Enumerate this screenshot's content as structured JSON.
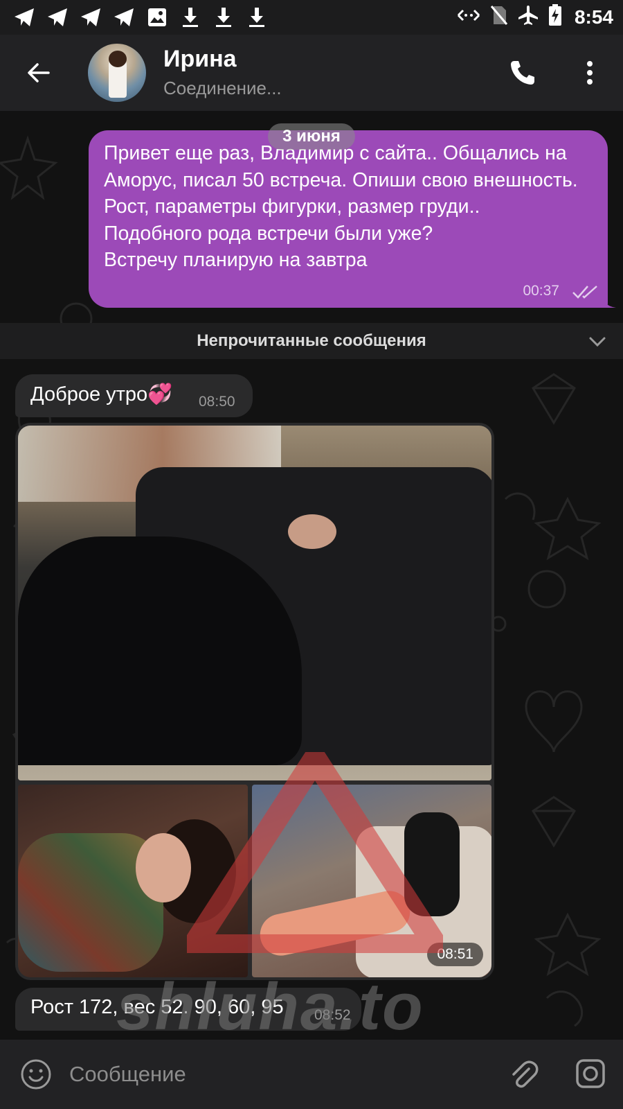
{
  "status_bar": {
    "time": "8:54",
    "left_icons": [
      "telegram-icon",
      "telegram-icon",
      "telegram-icon",
      "telegram-icon",
      "image-icon",
      "download-icon",
      "download-icon",
      "download-icon"
    ],
    "right_icons": [
      "data-saver-icon",
      "no-sim-icon",
      "airplane-icon",
      "battery-charging-icon"
    ]
  },
  "header": {
    "contact_name": "Ирина",
    "status": "Соединение..."
  },
  "chat": {
    "date_chip": "3 июня",
    "outgoing": {
      "text": "Привет еще раз, Владимир с сайта.. Общались на Аморус, писал 50 встреча. Опиши свою внешность. Рост, параметры фигурки, размер груди..\nПодобного рода встречи были уже?\nВстречу планирую на завтра",
      "time": "00:37",
      "status": "read"
    },
    "unread_label": "Непрочитанные сообщения",
    "incoming": [
      {
        "text": "Доброе утро💞",
        "time": "08:50"
      },
      {
        "text": "Рост 172, вес 52. 90, 60, 95",
        "time": "08:52"
      }
    ],
    "album": {
      "photos": 3,
      "time": "08:51"
    },
    "watermark": "shluha.to"
  },
  "input": {
    "placeholder": "Сообщение"
  },
  "colors": {
    "outgoing_bubble": "#9c4ab8",
    "incoming_bubble": "#2a2a2b",
    "header": "#222224",
    "background": "#121212"
  }
}
